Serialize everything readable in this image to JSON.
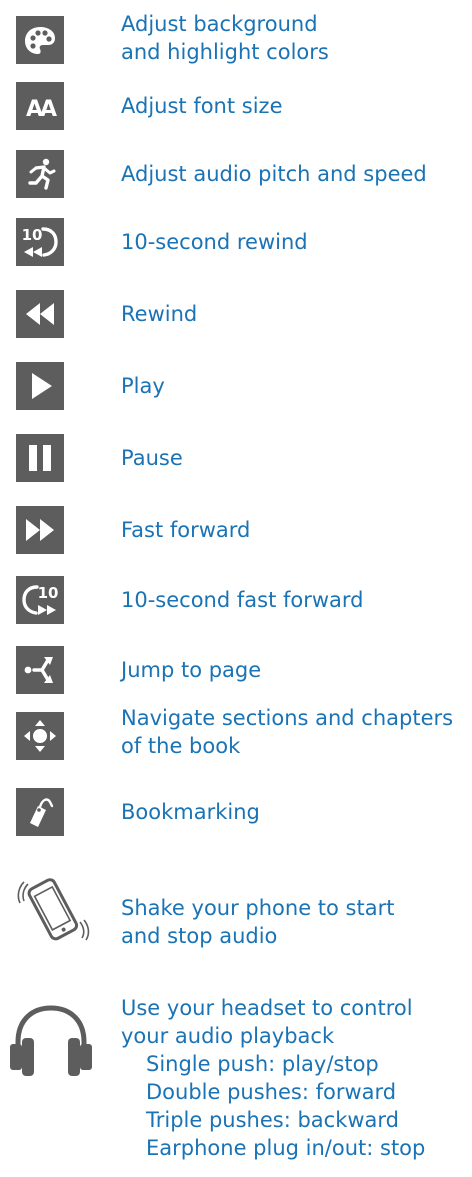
{
  "items": [
    {
      "icon": "palette-icon",
      "label_line1": "Adjust background",
      "label_line2": "and highlight colors"
    },
    {
      "icon": "font-size-icon",
      "label": "Adjust font size"
    },
    {
      "icon": "running-person-icon",
      "label": "Adjust audio pitch and speed"
    },
    {
      "icon": "rewind-10-icon",
      "label": "10-second rewind"
    },
    {
      "icon": "rewind-icon",
      "label": "Rewind"
    },
    {
      "icon": "play-icon",
      "label": "Play"
    },
    {
      "icon": "pause-icon",
      "label": "Pause"
    },
    {
      "icon": "fast-forward-icon",
      "label": "Fast forward"
    },
    {
      "icon": "forward-10-icon",
      "label": "10-second fast forward"
    },
    {
      "icon": "jump-to-page-icon",
      "label": "Jump to page"
    },
    {
      "icon": "navigate-arrows-icon",
      "label_line1": "Navigate sections and chapters",
      "label_line2": "of the book"
    },
    {
      "icon": "bookmark-tag-icon",
      "label": "Bookmarking"
    }
  ],
  "icon_glyphs": {
    "font_size_glyph": "AA",
    "rewind_10_number": "10",
    "forward_10_number": "10"
  },
  "shake": {
    "icon": "shaking-phone-icon",
    "line1": "Shake your phone to start",
    "line2": "and stop audio"
  },
  "headset": {
    "icon": "headphones-icon",
    "line1": "Use your headset to control",
    "line2": "your audio playback",
    "details": [
      "Single push: play/stop",
      "Double pushes: forward",
      "Triple pushes: backward",
      "Earphone plug in/out: stop"
    ]
  },
  "colors": {
    "text": "#1a73b5",
    "icon_bg": "#5d5d5d",
    "icon_fg": "#ffffff"
  }
}
